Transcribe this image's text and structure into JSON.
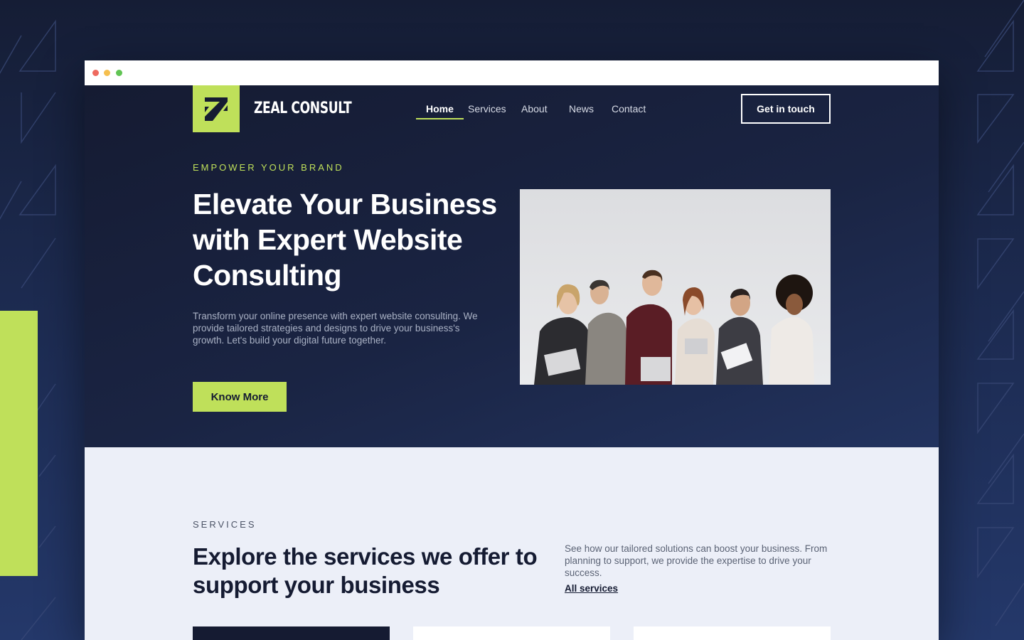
{
  "brand": {
    "name": "ZEAL CONSULT",
    "logo_letter": "Z",
    "accent_color": "#bfe05a"
  },
  "nav": {
    "items": [
      {
        "label": "Home",
        "active": true
      },
      {
        "label": "Services",
        "active": false
      },
      {
        "label": "About",
        "active": false
      },
      {
        "label": "News",
        "active": false
      },
      {
        "label": "Contact",
        "active": false
      }
    ],
    "cta_label": "Get in touch"
  },
  "hero": {
    "eyebrow": "EMPOWER YOUR BRAND",
    "title": "Elevate Your Business with Expert Website Consulting",
    "description": "Transform your online presence with expert website consulting. We provide tailored strategies and designs to drive your business's growth. Let's build your digital future together.",
    "button_label": "Know More",
    "image_icon": "team-photo"
  },
  "services": {
    "eyebrow": "SERVICES",
    "title": "Explore the services we offer to support your business",
    "description": "See how our tailored solutions can boost your business. From planning to support, we provide the expertise to drive your success.",
    "link_label": "All services"
  },
  "colors": {
    "dark_navy": "#151b32",
    "light_bg": "#eceff8"
  }
}
